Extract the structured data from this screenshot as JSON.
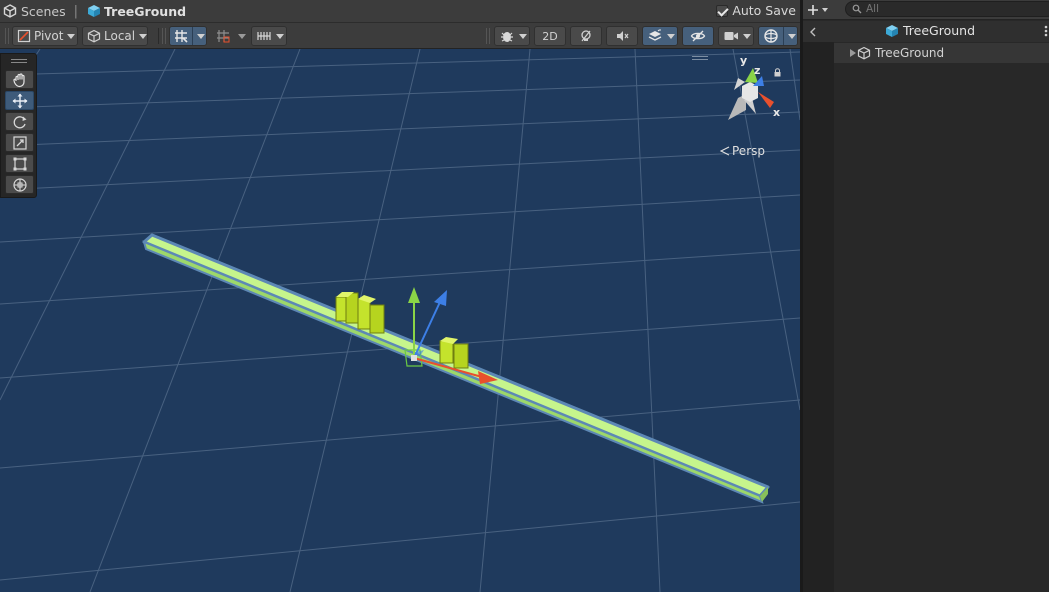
{
  "breadcrumb": {
    "scenes_label": "Scenes",
    "prefab_label": "TreeGround"
  },
  "autosave": {
    "label": "Auto Save",
    "checked": true
  },
  "toolbar": {
    "pivot_label": "Pivot",
    "space_label": "Local",
    "mode_2d_label": "2D",
    "pivot_icon": "pivot-icon",
    "local_icon": "cube-icon",
    "accent": "#46607c"
  },
  "tools": [
    {
      "name": "hand-tool",
      "icon": "hand-icon",
      "active": false
    },
    {
      "name": "move-tool",
      "icon": "move-icon",
      "active": true
    },
    {
      "name": "rotate-tool",
      "icon": "rotate-icon",
      "active": false
    },
    {
      "name": "scale-tool",
      "icon": "scale-icon",
      "active": false
    },
    {
      "name": "rect-tool",
      "icon": "rect-icon",
      "active": false
    },
    {
      "name": "transform-tool",
      "icon": "transform-icon",
      "active": false
    }
  ],
  "gizmo": {
    "y_label": "y",
    "z_label": "z",
    "x_label": "x",
    "projection_label": "Persp"
  },
  "hierarchy": {
    "search_placeholder": "All",
    "title": "TreeGround",
    "items": [
      {
        "label": "TreeGround",
        "expanded": false
      }
    ]
  },
  "colors": {
    "viewport_bg": "#1f3a5d",
    "ground": "#b8f07a",
    "leaves": "#c4e32c",
    "axis_x": "#e8502d",
    "axis_y": "#8ad447",
    "axis_z": "#3d7fe6"
  }
}
